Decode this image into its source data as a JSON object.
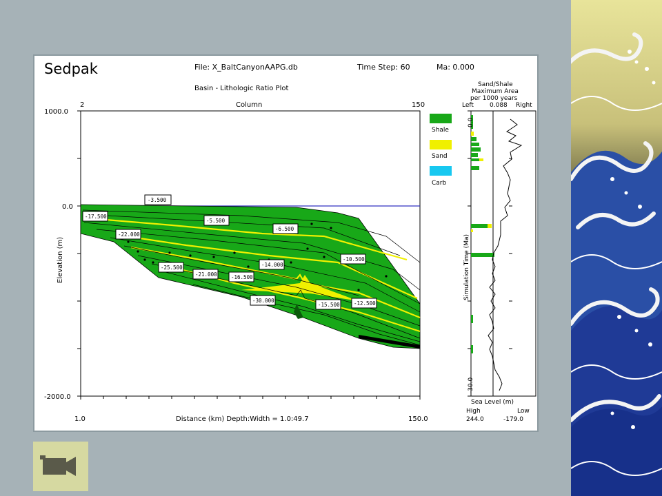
{
  "app": {
    "title": "Sedpak",
    "file": "File: X_BaltCanyonAAPG.db",
    "time_step": "Time Step: 60",
    "ma": "Ma: 0.000"
  },
  "plot": {
    "subtitle": "Basin - Lithologic Ratio Plot",
    "column_label": "Column",
    "column_start": "2",
    "column_end": "150",
    "y_axis_label": "Elevation (m)",
    "y_ticks": [
      "1000.0",
      "0.0",
      "-2000.0"
    ],
    "x_axis_label": "Distance (km)  Depth:Width = 1.0:49.7",
    "x_start": "1.0",
    "x_end": "150.0",
    "callouts": [
      "-3.500",
      "-17.500",
      "-22.000",
      "-5.500",
      "-6.500",
      "-25.500",
      "-21.000",
      "-16.500",
      "-14.000",
      "-10.500",
      "-30.000",
      "-15.500",
      "-12.500"
    ]
  },
  "legend": {
    "items": [
      {
        "label": "Shale",
        "color": "#18a818"
      },
      {
        "label": "Sand",
        "color": "#f0f000"
      },
      {
        "label": "Carb",
        "color": "#18c8f0"
      }
    ]
  },
  "side_panel": {
    "header_line1": "Sand/Shale",
    "header_line2": "Maximum Area",
    "header_line3": "per 1000 years",
    "left_label": "Left",
    "value": "0.088",
    "right_label": "Right",
    "axis_label": "Simulation Time (Ma)",
    "axis_top": "0.0",
    "axis_bottom": "-30.0",
    "sea_level_label": "Sea Level (m)",
    "high_label": "High",
    "low_label": "Low",
    "high_value": "244.0",
    "low_value": "-179.0"
  },
  "video_button": {
    "icon": "video-camera-icon",
    "color": "#d6d9a1"
  },
  "colors": {
    "background": "#a6b2b7",
    "shale": "#18a818",
    "sand": "#f0f000",
    "carb": "#18c8f0",
    "sea_level": "#3030c0"
  }
}
